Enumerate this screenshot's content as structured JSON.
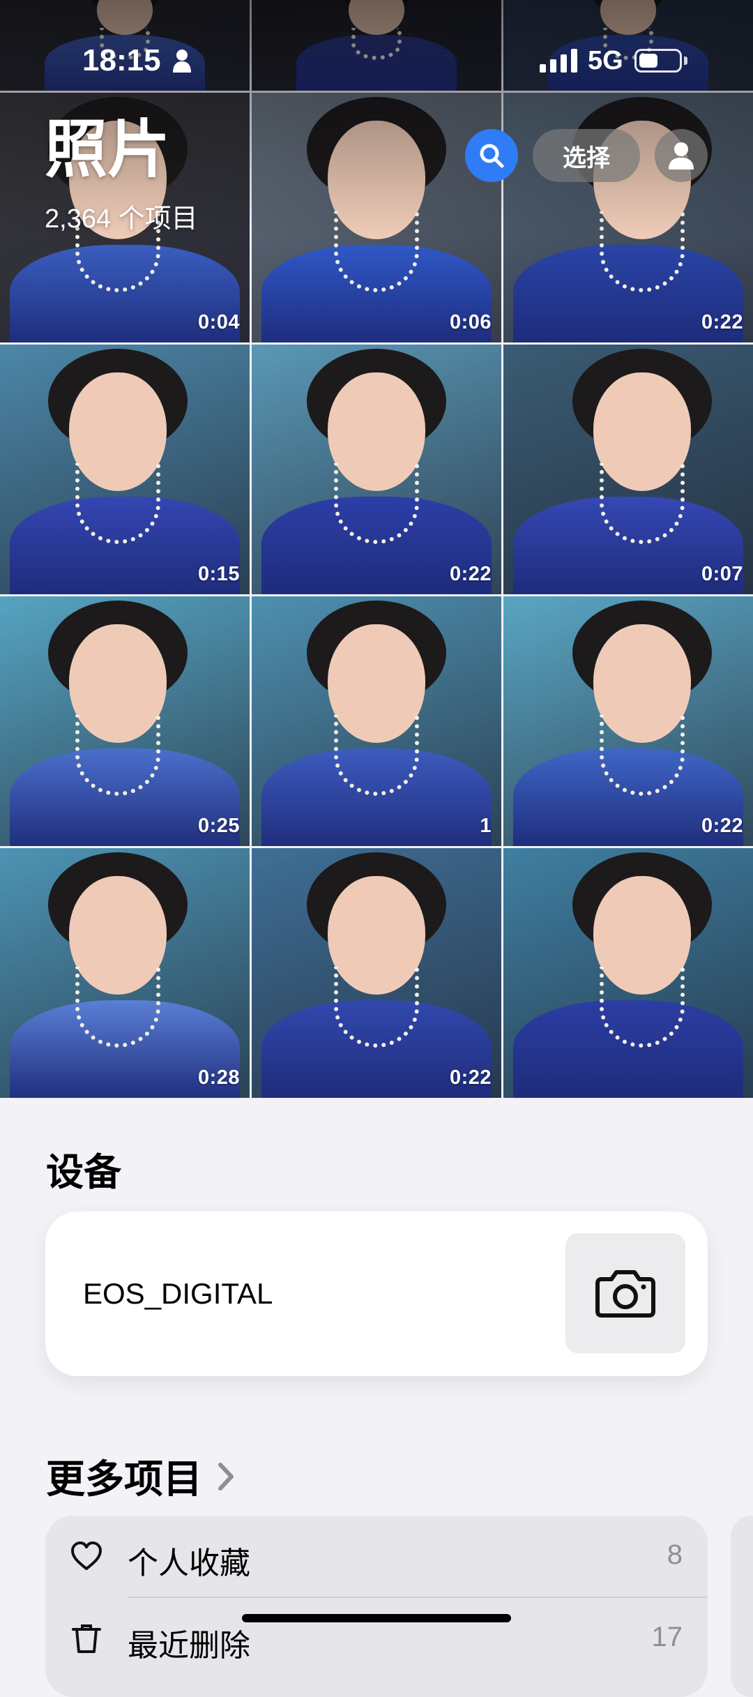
{
  "status_bar": {
    "time": "18:15",
    "network": "5G"
  },
  "header": {
    "title": "照片",
    "item_count": "2,364 个项目",
    "select_label": "选择",
    "search_icon": "search-icon",
    "profile_icon": "person-icon"
  },
  "grid": {
    "tiles": [
      {
        "duration": "",
        "bg": "#2a2a33",
        "robe": "#3f5fb8"
      },
      {
        "duration": "",
        "bg": "#22222a",
        "robe": "#2c3a8a"
      },
      {
        "duration": "",
        "bg": "#2b3a55",
        "robe": "#2d4aa8"
      },
      {
        "duration": "0:04",
        "bg": "#3b3a3e",
        "robe": "#3a5ec0"
      },
      {
        "duration": "0:06",
        "bg": "#6e7a88",
        "robe": "#2f58c8"
      },
      {
        "duration": "0:22",
        "bg": "#5b6d7f",
        "robe": "#2a44a6"
      },
      {
        "duration": "0:15",
        "bg": "#4c87a8",
        "robe": "#3446b2"
      },
      {
        "duration": "0:22",
        "bg": "#5a98b6",
        "robe": "#2c3fa8"
      },
      {
        "duration": "0:07",
        "bg": "#3a5c74",
        "robe": "#3548b4"
      },
      {
        "duration": "0:25",
        "bg": "#56a4c2",
        "robe": "#4a70cc"
      },
      {
        "duration": "1",
        "bg": "#4e90b0",
        "robe": "#3d5cbf"
      },
      {
        "duration": "0:22",
        "bg": "#5aa6c4",
        "robe": "#3f66c6"
      },
      {
        "duration": "0:28",
        "bg": "#4d94b4",
        "robe": "#5a7fd6"
      },
      {
        "duration": "0:22",
        "bg": "#3f6f96",
        "robe": "#3148ad"
      },
      {
        "duration": "",
        "bg": "#3f7fa2",
        "robe": "#2c3ea4"
      }
    ]
  },
  "devices": {
    "heading": "设备",
    "device_name": "EOS_DIGITAL",
    "device_icon": "camera-icon"
  },
  "more": {
    "heading": "更多项目",
    "items": [
      {
        "label": "个人收藏",
        "count": "8",
        "icon": "heart-icon"
      },
      {
        "label": "最近删除",
        "count": "17",
        "icon": "trash-icon"
      }
    ]
  }
}
